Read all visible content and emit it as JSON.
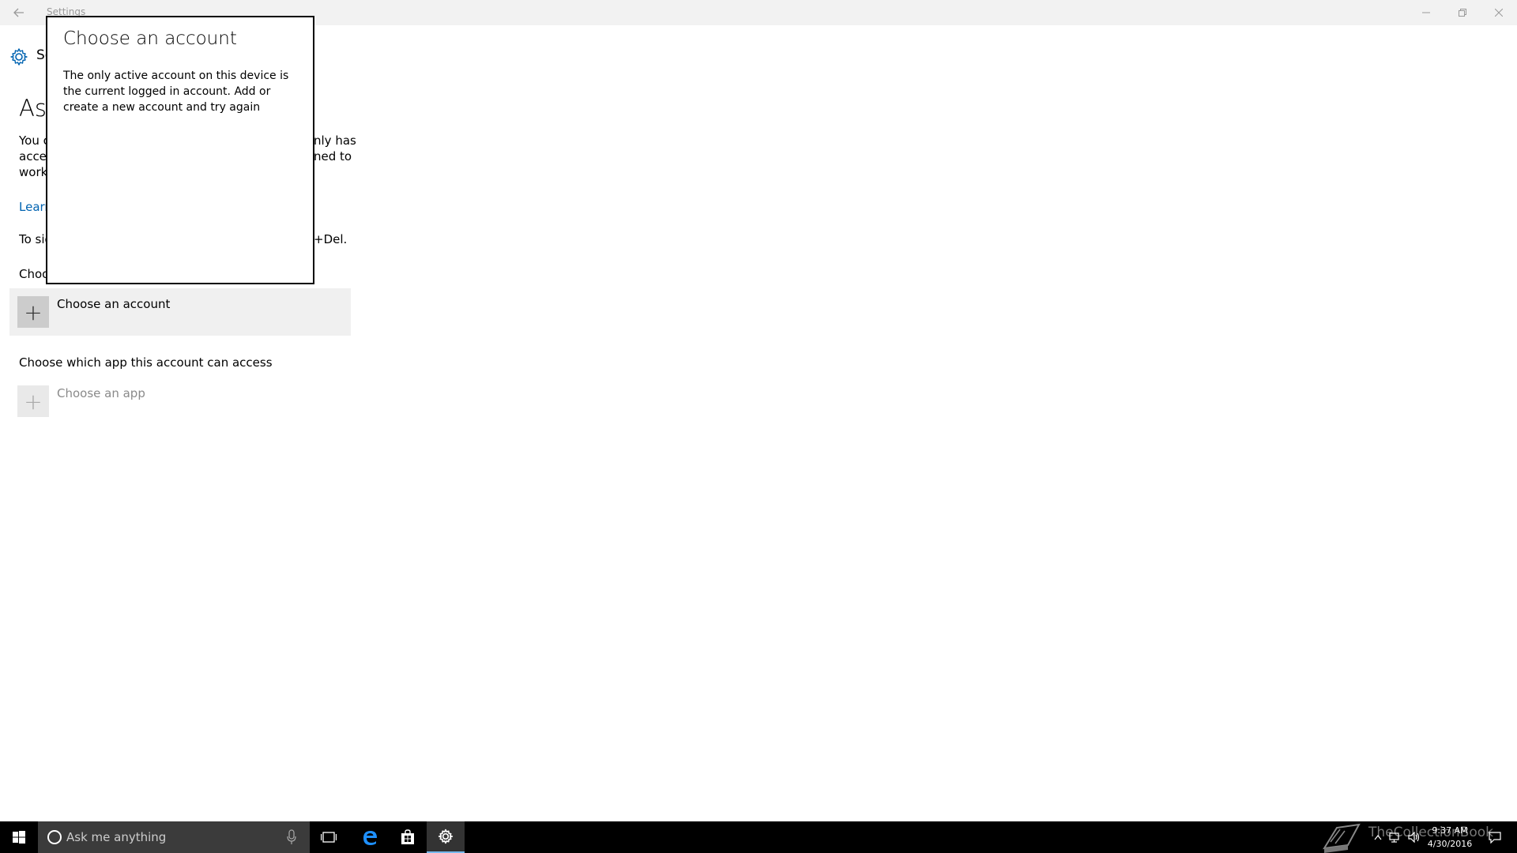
{
  "window": {
    "title": "Settings"
  },
  "settings": {
    "header_label": "Settings",
    "page_title": "Assigned access",
    "description_left": [
      "You c",
      "acces",
      "work"
    ],
    "description_right": [
      "nly has",
      "ned to",
      ""
    ],
    "learn_more": "Learn",
    "signin_left": "To sig",
    "signin_right": "+Del.",
    "choose_account_label": "Choo",
    "choose_account_button": "Choose an account",
    "choose_app_heading": "Choose which app this account can access",
    "choose_app_button": "Choose an app"
  },
  "dialog": {
    "title": "Choose an account",
    "message": "The only active account on this device is the current logged in account. Add or create a new account and try again"
  },
  "taskbar": {
    "search_placeholder": "Ask me anything",
    "watermark": "TheCollectionBook",
    "time": "9:37 AM",
    "date": "4/30/2016"
  },
  "colors": {
    "accent": "#0063b1",
    "taskbar_bg": "#000000",
    "titlebar_bg": "#f2f2f2"
  }
}
